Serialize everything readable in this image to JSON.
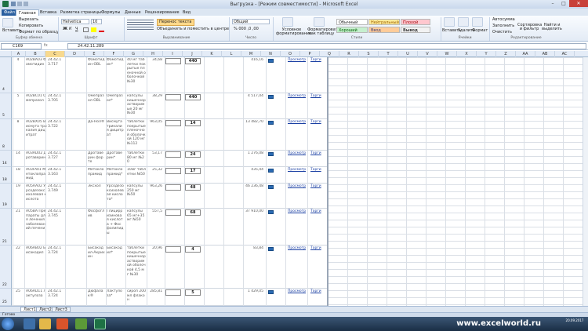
{
  "title": "Выгрузка - [Режим совместимости] - Microsoft Excel",
  "tabs": [
    "Файл",
    "Главная",
    "Вставка",
    "Разметка страницы",
    "Формулы",
    "Данные",
    "Рецензирование",
    "Вид"
  ],
  "ribbon": {
    "paste": "Вставить",
    "cut": "Вырезать",
    "copy": "Копировать",
    "format_painter": "Формат по образцу",
    "font_name": "Helvetica",
    "font_size": "10",
    "wrap_text": "Перенос текста",
    "merge": "Объединить и поместить в центре",
    "number_format": "Общий",
    "cond_format": "Условное форматирование",
    "format_table": "Форматировать как таблицу",
    "styles": [
      "Обычный",
      "Нейтральный",
      "Плохой",
      "Хороший",
      "Ввод",
      "Вывод"
    ],
    "insert": "Вставить",
    "delete": "Удалить",
    "format": "Формат",
    "autosum": "Автосумма",
    "fill": "Заполнить",
    "clear": "Очистить",
    "sort_filter": "Сортировка и фильтр",
    "find_select": "Найти и выделить",
    "groups": [
      "Буфер обмена",
      "Шрифт",
      "Выравнивание",
      "Число",
      "Стили",
      "Ячейки",
      "Редактирование"
    ]
  },
  "formula_bar": {
    "name_box": "C169",
    "fx": "fx",
    "value": "24.42.11.289"
  },
  "columns": [
    "A",
    "B",
    "C",
    "D",
    "E",
    "F",
    "G",
    "H",
    "I",
    "J",
    "K",
    "L",
    "M",
    "N",
    "O",
    "P",
    "Q",
    "R",
    "S",
    "T",
    "U",
    "V",
    "W",
    "X",
    "Y",
    "Z",
    "AA",
    "AB",
    "AC"
  ],
  "rows": [
    {
      "num": "4",
      "a": "4",
      "b": "A02BA03 Фамотидин",
      "c": "24.42.13.717",
      "e": "Фамотидин-OBL",
      "f": "Фамотидин*",
      "g": "40 мг таблетки покрытые пленочной оболочкой №30",
      "h": "34,68",
      "j": "440",
      "m": "416,16"
    },
    {
      "num": "5",
      "a": "5",
      "b": "A02BC01 Омепразол",
      "c": "24.42.13.705",
      "e": "Омепразол-OBL",
      "f": "Омепразол*",
      "g": "капсулы кишечнорастворимые 20 мг №30",
      "h": "38,29",
      "j": "440",
      "m": "4 517,04"
    },
    {
      "num": "8",
      "a": "8",
      "b": "A02BX05 Висмута трикалия дицитрат",
      "c": "24.42.13.722",
      "e": "Да-Нол®",
      "f": "Висмута трикалия дицитрат",
      "g": "таблетки покрытые пленочной оболочкой 120 мг №112",
      "h": "963,05",
      "j": "14",
      "m": "13 482,70"
    },
    {
      "num": "14",
      "a": "14",
      "b": "A03AD02 Дротаверин",
      "c": "24.42.13.727",
      "e": "Дротаверин форте",
      "f": "Дротаверин*",
      "g": "таблетки 80 мг №20",
      "h": "53,17",
      "j": "24",
      "m": "1 276,08"
    },
    {
      "num": "18",
      "a": "18",
      "b": "A03FA01 Метоклопрамид",
      "c": "24.42.13.163",
      "e": "Метоклопрамид",
      "f": "Метоклопрамид*",
      "g": "10мг таблетки №50",
      "h": "25,32",
      "j": "17",
      "m": "435,44"
    },
    {
      "num": "19",
      "a": "19",
      "b": "A05AA02 Урсодезоксихолевая кислота",
      "c": "24.42.13.749",
      "e": "Эксхол",
      "f": "Урсодезоксихолевая кислота*",
      "g": "капсулы 250 мг №50",
      "h": "963,26",
      "j": "48",
      "m": "46 236,48"
    },
    {
      "num": "21",
      "a": "21",
      "b": "A05BA Препараты для лечения заболеваний печени",
      "c": "24.42.13.745",
      "e": "Фосфоглив",
      "f": "Глицирризиновая кислота + Фосфолипиды",
      "g": "капсулы 65 мг+35 мг №50",
      "h": "557,5",
      "j": "68",
      "m": "37 910,00"
    },
    {
      "num": "22",
      "a": "22",
      "b": "A06AB02 Бисакодил",
      "c": "24.42.13.724",
      "e": "Бисакодил-Акрихин",
      "f": "Бисакодил*",
      "g": "таблетки покрытые кишечнорастворимой оболочкой 4,5 мг №30",
      "h": "20,96",
      "j": "4",
      "m": "83,84"
    },
    {
      "num": "25",
      "a": "25",
      "b": "A06AD11 Лактулоза",
      "c": "24.42.13.724",
      "e": "Дюфалак®",
      "f": "Лактулоза*",
      "g": "сироп 200 мл флакон",
      "h": "285,81",
      "j": "5",
      "m": "1 429,05"
    }
  ],
  "links": {
    "view": "Просмотр",
    "bids": "Торги"
  },
  "sheets": [
    "Лист1",
    "Лист2",
    "Лист3"
  ],
  "status": "Готово",
  "watermark": "www.excelworld.ru",
  "clock": "20.09.2017"
}
